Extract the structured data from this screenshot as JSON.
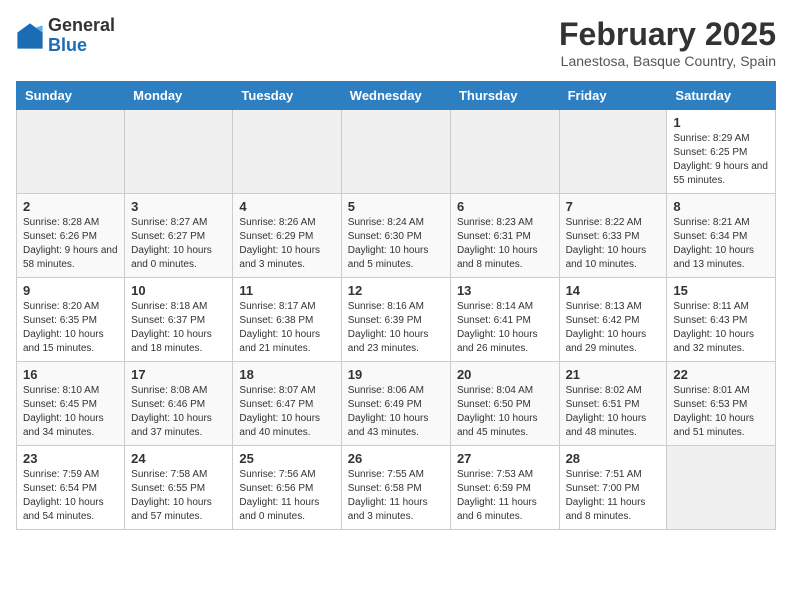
{
  "header": {
    "logo_general": "General",
    "logo_blue": "Blue",
    "month_title": "February 2025",
    "location": "Lanestosa, Basque Country, Spain"
  },
  "weekdays": [
    "Sunday",
    "Monday",
    "Tuesday",
    "Wednesday",
    "Thursday",
    "Friday",
    "Saturday"
  ],
  "weeks": [
    [
      {
        "day": "",
        "info": ""
      },
      {
        "day": "",
        "info": ""
      },
      {
        "day": "",
        "info": ""
      },
      {
        "day": "",
        "info": ""
      },
      {
        "day": "",
        "info": ""
      },
      {
        "day": "",
        "info": ""
      },
      {
        "day": "1",
        "info": "Sunrise: 8:29 AM\nSunset: 6:25 PM\nDaylight: 9 hours and 55 minutes."
      }
    ],
    [
      {
        "day": "2",
        "info": "Sunrise: 8:28 AM\nSunset: 6:26 PM\nDaylight: 9 hours and 58 minutes."
      },
      {
        "day": "3",
        "info": "Sunrise: 8:27 AM\nSunset: 6:27 PM\nDaylight: 10 hours and 0 minutes."
      },
      {
        "day": "4",
        "info": "Sunrise: 8:26 AM\nSunset: 6:29 PM\nDaylight: 10 hours and 3 minutes."
      },
      {
        "day": "5",
        "info": "Sunrise: 8:24 AM\nSunset: 6:30 PM\nDaylight: 10 hours and 5 minutes."
      },
      {
        "day": "6",
        "info": "Sunrise: 8:23 AM\nSunset: 6:31 PM\nDaylight: 10 hours and 8 minutes."
      },
      {
        "day": "7",
        "info": "Sunrise: 8:22 AM\nSunset: 6:33 PM\nDaylight: 10 hours and 10 minutes."
      },
      {
        "day": "8",
        "info": "Sunrise: 8:21 AM\nSunset: 6:34 PM\nDaylight: 10 hours and 13 minutes."
      }
    ],
    [
      {
        "day": "9",
        "info": "Sunrise: 8:20 AM\nSunset: 6:35 PM\nDaylight: 10 hours and 15 minutes."
      },
      {
        "day": "10",
        "info": "Sunrise: 8:18 AM\nSunset: 6:37 PM\nDaylight: 10 hours and 18 minutes."
      },
      {
        "day": "11",
        "info": "Sunrise: 8:17 AM\nSunset: 6:38 PM\nDaylight: 10 hours and 21 minutes."
      },
      {
        "day": "12",
        "info": "Sunrise: 8:16 AM\nSunset: 6:39 PM\nDaylight: 10 hours and 23 minutes."
      },
      {
        "day": "13",
        "info": "Sunrise: 8:14 AM\nSunset: 6:41 PM\nDaylight: 10 hours and 26 minutes."
      },
      {
        "day": "14",
        "info": "Sunrise: 8:13 AM\nSunset: 6:42 PM\nDaylight: 10 hours and 29 minutes."
      },
      {
        "day": "15",
        "info": "Sunrise: 8:11 AM\nSunset: 6:43 PM\nDaylight: 10 hours and 32 minutes."
      }
    ],
    [
      {
        "day": "16",
        "info": "Sunrise: 8:10 AM\nSunset: 6:45 PM\nDaylight: 10 hours and 34 minutes."
      },
      {
        "day": "17",
        "info": "Sunrise: 8:08 AM\nSunset: 6:46 PM\nDaylight: 10 hours and 37 minutes."
      },
      {
        "day": "18",
        "info": "Sunrise: 8:07 AM\nSunset: 6:47 PM\nDaylight: 10 hours and 40 minutes."
      },
      {
        "day": "19",
        "info": "Sunrise: 8:06 AM\nSunset: 6:49 PM\nDaylight: 10 hours and 43 minutes."
      },
      {
        "day": "20",
        "info": "Sunrise: 8:04 AM\nSunset: 6:50 PM\nDaylight: 10 hours and 45 minutes."
      },
      {
        "day": "21",
        "info": "Sunrise: 8:02 AM\nSunset: 6:51 PM\nDaylight: 10 hours and 48 minutes."
      },
      {
        "day": "22",
        "info": "Sunrise: 8:01 AM\nSunset: 6:53 PM\nDaylight: 10 hours and 51 minutes."
      }
    ],
    [
      {
        "day": "23",
        "info": "Sunrise: 7:59 AM\nSunset: 6:54 PM\nDaylight: 10 hours and 54 minutes."
      },
      {
        "day": "24",
        "info": "Sunrise: 7:58 AM\nSunset: 6:55 PM\nDaylight: 10 hours and 57 minutes."
      },
      {
        "day": "25",
        "info": "Sunrise: 7:56 AM\nSunset: 6:56 PM\nDaylight: 11 hours and 0 minutes."
      },
      {
        "day": "26",
        "info": "Sunrise: 7:55 AM\nSunset: 6:58 PM\nDaylight: 11 hours and 3 minutes."
      },
      {
        "day": "27",
        "info": "Sunrise: 7:53 AM\nSunset: 6:59 PM\nDaylight: 11 hours and 6 minutes."
      },
      {
        "day": "28",
        "info": "Sunrise: 7:51 AM\nSunset: 7:00 PM\nDaylight: 11 hours and 8 minutes."
      },
      {
        "day": "",
        "info": ""
      }
    ]
  ]
}
